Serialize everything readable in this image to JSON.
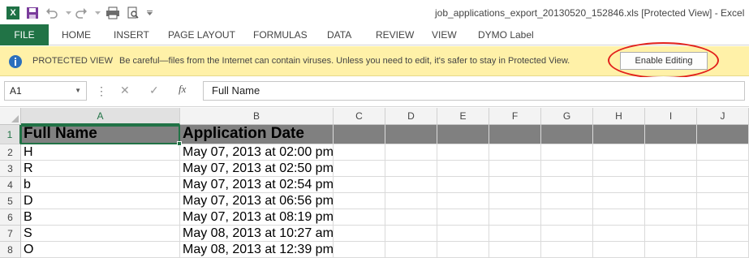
{
  "window": {
    "title": "job_applications_export_20130520_152846.xls  [Protected View] - Excel"
  },
  "quick_access": {
    "icons": [
      "excel-logo-icon",
      "save-icon",
      "undo-icon",
      "redo-icon",
      "print-icon",
      "print-preview-icon",
      "customize-dropdown-icon"
    ],
    "logo_letter": "X"
  },
  "ribbon": {
    "file_label": "FILE",
    "tabs": [
      "HOME",
      "INSERT",
      "PAGE LAYOUT",
      "FORMULAS",
      "DATA",
      "REVIEW",
      "VIEW",
      "DYMO Label"
    ]
  },
  "protected_view": {
    "title": "PROTECTED VIEW",
    "message": "Be careful—files from the Internet can contain viruses. Unless you need to edit, it's safer to stay in Protected View.",
    "button_label": "Enable Editing"
  },
  "formula_bar": {
    "name_box": "A1",
    "fx_label": "fx",
    "content": "Full Name"
  },
  "sheet": {
    "columns": [
      "A",
      "B",
      "C",
      "D",
      "E",
      "F",
      "G",
      "H",
      "I",
      "J"
    ],
    "row_numbers": [
      "1",
      "2",
      "3",
      "4",
      "5",
      "6",
      "7",
      "8"
    ],
    "header": [
      "Full Name",
      "Application Date"
    ],
    "rows": [
      [
        "H",
        "May 07, 2013 at 02:00 pm"
      ],
      [
        "R",
        "May 07, 2013 at 02:50 pm"
      ],
      [
        "b",
        "May 07, 2013 at 02:54 pm"
      ],
      [
        "D",
        "May 07, 2013 at 06:56 pm"
      ],
      [
        "B",
        "May 07, 2013 at 08:19 pm"
      ],
      [
        "S",
        "May 08, 2013 at 10:27 am"
      ],
      [
        "O",
        "May 08, 2013 at 12:39 pm"
      ]
    ]
  },
  "colors": {
    "excel_green": "#217346",
    "warning_bar": "#fff1a8",
    "header_fill": "#808080",
    "highlight_ellipse": "#e2211c"
  }
}
